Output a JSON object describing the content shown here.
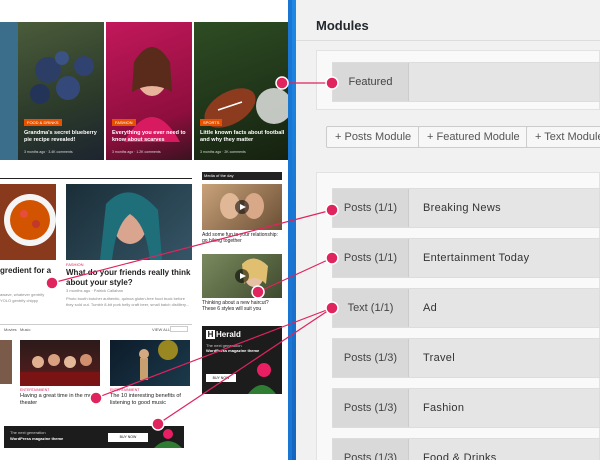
{
  "panel": {
    "title": "Modules",
    "featured_row": {
      "type": "Featured"
    },
    "buttons": [
      "+ Posts Module",
      "+ Featured Module",
      "+ Text Module"
    ],
    "modules": [
      {
        "type": "Posts (1/1)",
        "title": "Breaking News"
      },
      {
        "type": "Posts (1/1)",
        "title": "Entertainment Today"
      },
      {
        "type": "Text (1/1)",
        "title": "Ad"
      },
      {
        "type": "Posts (1/3)",
        "title": "Travel"
      },
      {
        "type": "Posts (1/3)",
        "title": "Fashion"
      },
      {
        "type": "Posts (1/3)",
        "title": "Food & Drinks"
      }
    ]
  },
  "site": {
    "slides": [
      {
        "tag": "FOOD & DRINKS",
        "caption": "Grandma's secret blueberry pie recipe revealed!",
        "meta": "3 months ago · 3.4K comments"
      },
      {
        "tag": "FASHION",
        "caption": "Everything you ever need to know about scarves",
        "meta": "3 months ago · 1.2K comments"
      },
      {
        "tag": "SPORTS",
        "caption": "Little known facts about football and why they matter",
        "meta": "3 months ago · 2K comments"
      }
    ],
    "left_partial_title": "gredient for a",
    "left_partial_text": "awave, whatever gentrify YOLO gentrify chippy",
    "feature_tag": "FASHION",
    "feature_title": "What do your friends really think about your style?",
    "feature_text": "Photo booth butcher authentic, quinoa gluten-free food truck before they sold out. Tumblr 8-bit pork belly craft beer, small batch distillery...",
    "feature_meta": "3 months ago · Patrick Callahan",
    "media_label": "Media of the day",
    "media_items": [
      "Add some fun to your relationship: go hiking together",
      "Thinking about a new haircut? These 6 styles will suit you"
    ],
    "section_tabs": [
      "Movies",
      "Music"
    ],
    "section_nav": "VIEW ALL",
    "grid_items": [
      {
        "tag": "ENTERTAINMENT",
        "title": "Having a great time in the movie theater"
      },
      {
        "tag": "ENTERTAINMENT",
        "title": "The 10 interesting benefits of listening to good music"
      }
    ],
    "ad": {
      "logo": "Herald",
      "line1": "The next generation",
      "line2": "WordPress magazine theme",
      "button": "BUY NOW"
    },
    "banner": {
      "line1": "The next generation",
      "line2": "WordPress magazine theme",
      "button": "BUY NOW"
    }
  },
  "colors": {
    "accent": "#e0245e",
    "panel_bg": "#f1f1f1",
    "row_bg": "#e5e5e5",
    "frame": "#1976d2"
  }
}
